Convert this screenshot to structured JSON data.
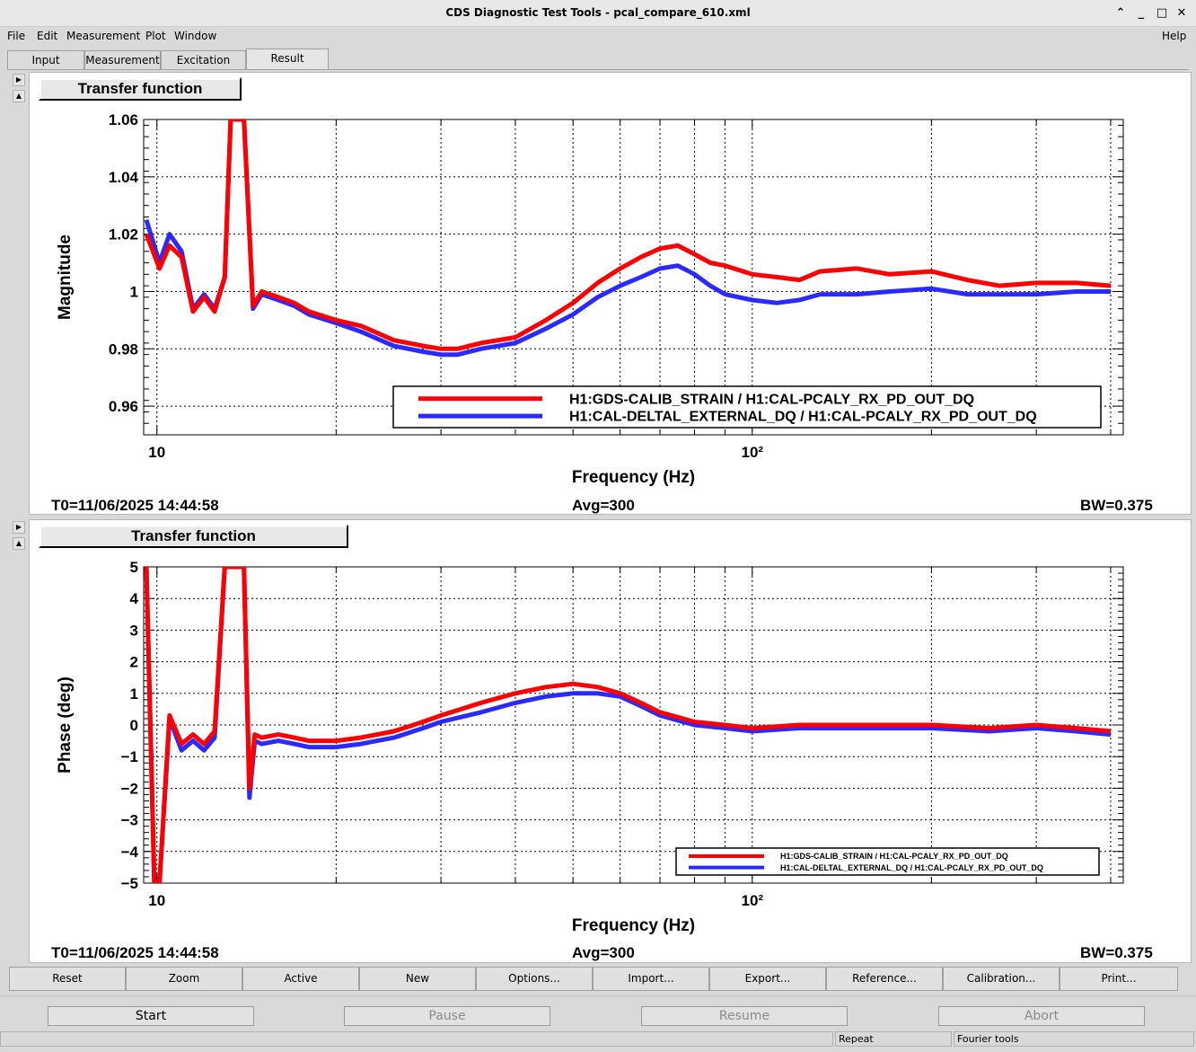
{
  "window": {
    "title": "CDS Diagnostic Test Tools - pcal_compare_610.xml"
  },
  "menu": [
    "File",
    "Edit",
    "Measurement",
    "Plot",
    "Window"
  ],
  "menu_help": "Help",
  "tabs": [
    "Input",
    "Measurement",
    "Excitation",
    "Result"
  ],
  "active_tab": "Result",
  "plots": [
    {
      "panel_title": "Transfer function",
      "ylabel": "Magnitude",
      "xlabel": "Frequency (Hz)",
      "t0": "T0=11/06/2025 14:44:58",
      "avg": "Avg=300",
      "bw": "BW=0.375",
      "legend": [
        "H1:GDS-CALIB_STRAIN / H1:CAL-PCALY_RX_PD_OUT_DQ",
        "H1:CAL-DELTAL_EXTERNAL_DQ / H1:CAL-PCALY_RX_PD_OUT_DQ"
      ],
      "xtick_labels": [
        "10",
        "10²"
      ]
    },
    {
      "panel_title": "Transfer function",
      "ylabel": "Phase (deg)",
      "xlabel": "Frequency (Hz)",
      "t0": "T0=11/06/2025 14:44:58",
      "avg": "Avg=300",
      "bw": "BW=0.375",
      "legend": [
        "H1:GDS-CALIB_STRAIN / H1:CAL-PCALY_RX_PD_OUT_DQ",
        "H1:CAL-DELTAL_EXTERNAL_DQ / H1:CAL-PCALY_RX_PD_OUT_DQ"
      ],
      "xtick_labels": [
        "10",
        "10²"
      ]
    }
  ],
  "buttons": [
    "Reset",
    "Zoom",
    "Active",
    "New",
    "Options...",
    "Import...",
    "Export...",
    "Reference...",
    "Calibration...",
    "Print..."
  ],
  "controls": {
    "start": "Start",
    "pause": "Pause",
    "resume": "Resume",
    "abort": "Abort"
  },
  "status": {
    "repeat": "Repeat",
    "fourier": "Fourier tools"
  },
  "colors": {
    "series1": "#ff0000",
    "series2": "#2a2aff"
  },
  "chart_data": [
    {
      "type": "line",
      "xscale": "log",
      "xlim": [
        9.5,
        420
      ],
      "ylim": [
        0.95,
        1.06
      ],
      "yticks": [
        0.96,
        0.98,
        1,
        1.02,
        1.04,
        1.06
      ],
      "ytick_labels": [
        "0.96",
        "0.98",
        "1",
        "1.02",
        "1.04",
        "1.06"
      ],
      "series": [
        {
          "name": "H1:GDS-CALIB_STRAIN / H1:CAL-PCALY_RX_PD_OUT_DQ",
          "x": [
            9.6,
            10.1,
            10.5,
            11,
            11.5,
            12,
            12.5,
            13,
            13.3,
            14,
            14.5,
            15,
            16,
            17,
            18,
            20,
            22,
            25,
            28,
            30,
            32,
            35,
            40,
            45,
            50,
            55,
            60,
            65,
            70,
            75,
            80,
            85,
            90,
            100,
            110,
            120,
            130,
            150,
            170,
            200,
            230,
            260,
            300,
            350,
            400
          ],
          "y": [
            1.02,
            1.008,
            1.016,
            1.012,
            0.993,
            0.998,
            0.993,
            1.005,
            1.06,
            1.06,
            0.995,
            1.0,
            0.998,
            0.996,
            0.993,
            0.99,
            0.988,
            0.983,
            0.981,
            0.98,
            0.98,
            0.982,
            0.984,
            0.99,
            0.996,
            1.003,
            1.008,
            1.012,
            1.015,
            1.016,
            1.013,
            1.01,
            1.009,
            1.006,
            1.005,
            1.004,
            1.007,
            1.008,
            1.006,
            1.007,
            1.004,
            1.002,
            1.003,
            1.003,
            1.002
          ]
        },
        {
          "name": "H1:CAL-DELTAL_EXTERNAL_DQ / H1:CAL-PCALY_RX_PD_OUT_DQ",
          "x": [
            9.6,
            10.1,
            10.5,
            11,
            11.5,
            12,
            12.5,
            13,
            13.3,
            14,
            14.5,
            15,
            16,
            17,
            18,
            20,
            22,
            25,
            28,
            30,
            32,
            35,
            40,
            45,
            50,
            55,
            60,
            65,
            70,
            75,
            80,
            85,
            90,
            100,
            110,
            120,
            130,
            150,
            170,
            200,
            230,
            260,
            300,
            350,
            400
          ],
          "y": [
            1.025,
            1.01,
            1.02,
            1.014,
            0.994,
            0.999,
            0.994,
            1.005,
            1.06,
            1.06,
            0.994,
            0.999,
            0.997,
            0.995,
            0.992,
            0.989,
            0.986,
            0.981,
            0.979,
            0.978,
            0.978,
            0.98,
            0.982,
            0.987,
            0.992,
            0.998,
            1.002,
            1.005,
            1.008,
            1.009,
            1.006,
            1.002,
            0.999,
            0.997,
            0.996,
            0.997,
            0.999,
            0.999,
            1.0,
            1.001,
            0.999,
            0.999,
            0.999,
            1.0,
            1.0
          ]
        }
      ]
    },
    {
      "type": "line",
      "xscale": "log",
      "xlim": [
        9.5,
        420
      ],
      "ylim": [
        -5,
        5
      ],
      "yticks": [
        -5,
        -4,
        -3,
        -2,
        -1,
        0,
        1,
        2,
        3,
        4,
        5
      ],
      "ytick_labels": [
        "−5",
        "−4",
        "−3",
        "−2",
        "−1",
        "0",
        "1",
        "2",
        "3",
        "4",
        "5"
      ],
      "series": [
        {
          "name": "H1:GDS-CALIB_STRAIN / H1:CAL-PCALY_RX_PD_OUT_DQ",
          "x": [
            9.6,
            9.9,
            10.1,
            10.5,
            11,
            11.5,
            12,
            12.5,
            13,
            13.3,
            14,
            14.3,
            14.6,
            15,
            16,
            17,
            18,
            20,
            22,
            25,
            28,
            30,
            35,
            40,
            45,
            50,
            55,
            60,
            65,
            70,
            80,
            90,
            100,
            120,
            150,
            200,
            250,
            300,
            350,
            400
          ],
          "y": [
            5,
            -5,
            -5,
            0.3,
            -0.6,
            -0.3,
            -0.6,
            -0.2,
            5,
            5,
            5,
            -2,
            -0.3,
            -0.4,
            -0.3,
            -0.4,
            -0.5,
            -0.5,
            -0.4,
            -0.2,
            0.1,
            0.3,
            0.7,
            1.0,
            1.2,
            1.3,
            1.2,
            1.0,
            0.7,
            0.4,
            0.1,
            0.0,
            -0.1,
            0.0,
            0.0,
            0.0,
            -0.1,
            0.0,
            -0.1,
            -0.2
          ]
        },
        {
          "name": "H1:CAL-DELTAL_EXTERNAL_DQ / H1:CAL-PCALY_RX_PD_OUT_DQ",
          "x": [
            9.6,
            9.9,
            10.1,
            10.5,
            11,
            11.5,
            12,
            12.5,
            13,
            13.3,
            14,
            14.3,
            14.6,
            15,
            16,
            17,
            18,
            20,
            22,
            25,
            28,
            30,
            35,
            40,
            45,
            50,
            55,
            60,
            65,
            70,
            80,
            90,
            100,
            120,
            150,
            200,
            250,
            300,
            350,
            400
          ],
          "y": [
            5,
            -5,
            -5,
            0.2,
            -0.8,
            -0.5,
            -0.8,
            -0.4,
            5,
            5,
            5,
            -2.3,
            -0.5,
            -0.6,
            -0.5,
            -0.6,
            -0.7,
            -0.7,
            -0.6,
            -0.4,
            -0.1,
            0.1,
            0.4,
            0.7,
            0.9,
            1.0,
            1.0,
            0.9,
            0.6,
            0.3,
            0.0,
            -0.1,
            -0.2,
            -0.1,
            -0.1,
            -0.1,
            -0.2,
            -0.1,
            -0.2,
            -0.3
          ]
        }
      ]
    }
  ]
}
